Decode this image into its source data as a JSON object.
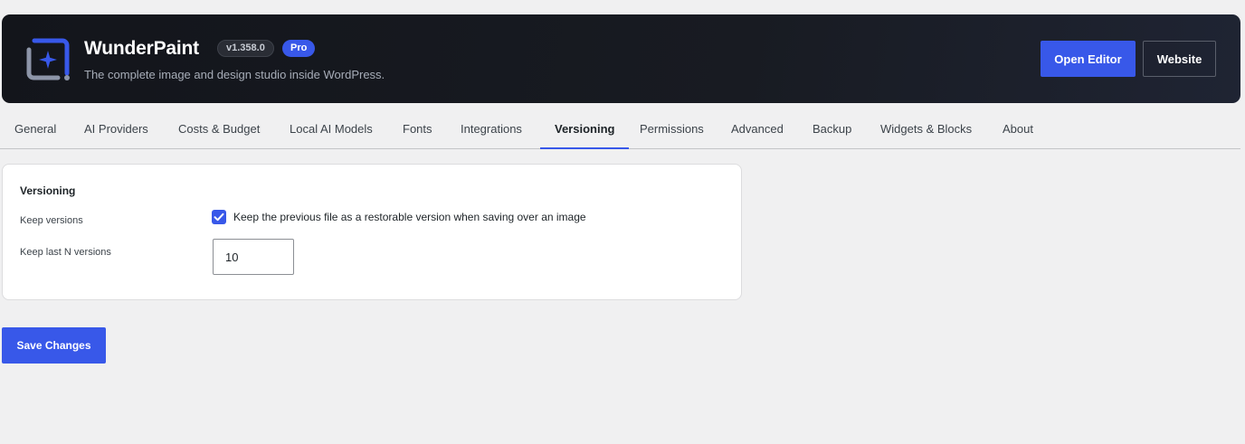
{
  "header": {
    "app_name": "WunderPaint",
    "version": "v1.358.0",
    "plan_badge": "Pro",
    "subtitle": "The complete image and design studio inside WordPress.",
    "logo_icon": "sparkle-frame-icon",
    "open_editor_label": "Open Editor",
    "website_label": "Website"
  },
  "tabs": [
    {
      "label": "General",
      "active": false
    },
    {
      "label": "AI Providers",
      "active": false
    },
    {
      "label": "Costs & Budget",
      "active": false
    },
    {
      "label": "Local AI Models",
      "active": false
    },
    {
      "label": "Fonts",
      "active": false
    },
    {
      "label": "Integrations",
      "active": false
    },
    {
      "label": "Versioning",
      "active": true
    },
    {
      "label": "Permissions",
      "active": false
    },
    {
      "label": "Advanced",
      "active": false
    },
    {
      "label": "Backup",
      "active": false
    },
    {
      "label": "Widgets & Blocks",
      "active": false
    },
    {
      "label": "About",
      "active": false
    }
  ],
  "versioning": {
    "section_title": "Versioning",
    "keep_versions_label": "Keep versions",
    "keep_versions_checked": true,
    "keep_versions_description": "Keep the previous file as a restorable version when saving over an image",
    "keep_last_label": "Keep last N versions",
    "keep_last_value": "10"
  },
  "footer": {
    "save_label": "Save Changes"
  },
  "colors": {
    "accent": "#3858e9",
    "header_bg": "#181b22",
    "page_bg": "#f0f0f1"
  }
}
